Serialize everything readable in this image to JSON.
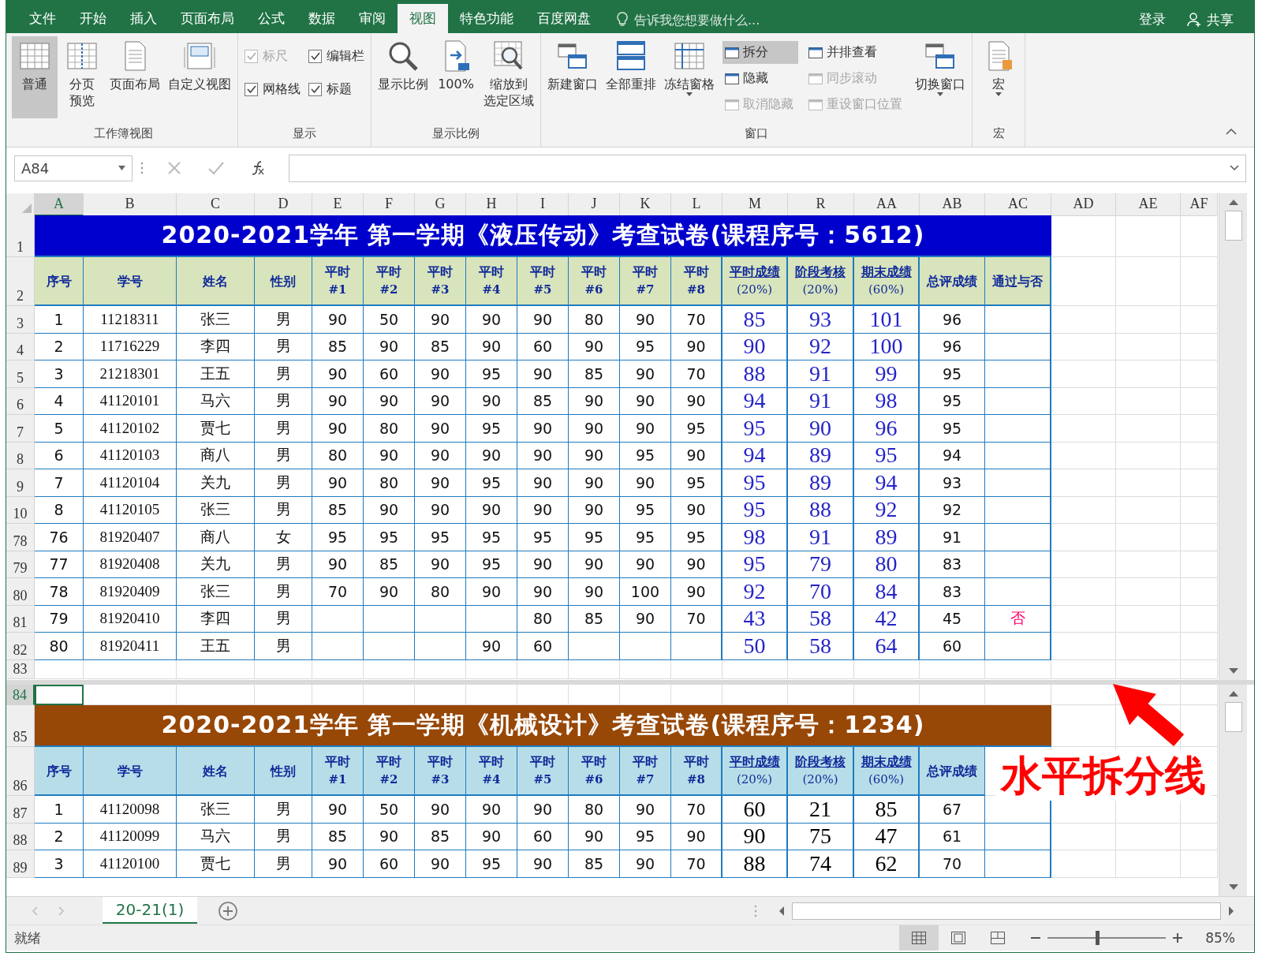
{
  "menu_tabs": [
    {
      "label": "文件",
      "selected": false
    },
    {
      "label": "开始",
      "selected": false
    },
    {
      "label": "插入",
      "selected": false
    },
    {
      "label": "页面布局",
      "selected": false
    },
    {
      "label": "公式",
      "selected": false
    },
    {
      "label": "数据",
      "selected": false
    },
    {
      "label": "审阅",
      "selected": false
    },
    {
      "label": "视图",
      "selected": true
    },
    {
      "label": "特色功能",
      "selected": false
    },
    {
      "label": "百度网盘",
      "selected": false
    }
  ],
  "tell_me": {
    "placeholder": "告诉我您想要做什么..."
  },
  "account": {
    "login": "登录",
    "share": "共享"
  },
  "ribbon_groups": [
    {
      "label": "工作簿视图",
      "items": [
        {
          "kind": "large",
          "label": "普通",
          "selected": true
        },
        {
          "kind": "large",
          "lines": [
            "分页",
            "预览"
          ],
          "selected": false
        },
        {
          "kind": "large",
          "label": "页面布局",
          "selected": false
        },
        {
          "kind": "large",
          "label": "自定义视图",
          "selected": false
        }
      ]
    },
    {
      "label": "显示",
      "items": [
        {
          "kind": "stack",
          "items": [
            {
              "kind": "check",
              "label": "标尺",
              "checked": true,
              "disabled": true
            },
            {
              "kind": "check",
              "label": "网格线",
              "checked": true,
              "disabled": false
            }
          ]
        },
        {
          "kind": "stack",
          "items": [
            {
              "kind": "check",
              "label": "编辑栏",
              "checked": true,
              "disabled": false
            },
            {
              "kind": "check",
              "label": "标题",
              "checked": true,
              "disabled": false
            }
          ]
        }
      ]
    },
    {
      "label": "显示比例",
      "items": [
        {
          "kind": "large",
          "label": "显示比例"
        },
        {
          "kind": "large",
          "label": "100%"
        },
        {
          "kind": "large",
          "lines": [
            "缩放到",
            "选定区域"
          ]
        }
      ]
    },
    {
      "label": "窗口",
      "items": [
        {
          "kind": "large",
          "label": "新建窗口"
        },
        {
          "kind": "large",
          "label": "全部重排"
        },
        {
          "kind": "large",
          "label": "冻结窗格",
          "dropdown": true
        },
        {
          "kind": "stack",
          "items": [
            {
              "kind": "small",
              "label": "拆分",
              "selected": true,
              "disabled": false
            },
            {
              "kind": "small",
              "label": "隐藏",
              "selected": false,
              "disabled": false
            },
            {
              "kind": "small",
              "label": "取消隐藏",
              "selected": false,
              "disabled": true
            }
          ]
        },
        {
          "kind": "stack",
          "items": [
            {
              "kind": "small",
              "label": "并排查看",
              "selected": false,
              "disabled": false
            },
            {
              "kind": "small",
              "label": "同步滚动",
              "selected": false,
              "disabled": true
            },
            {
              "kind": "small",
              "label": "重设窗口位置",
              "selected": false,
              "disabled": true
            }
          ]
        },
        {
          "kind": "large",
          "label": "切换窗口",
          "dropdown": true
        }
      ]
    },
    {
      "label": "宏",
      "items": [
        {
          "kind": "large",
          "label": "宏",
          "dropdown": true
        }
      ]
    }
  ],
  "formula_bar": {
    "name_box": "A84"
  },
  "columns": [
    {
      "label": "A",
      "selected": true
    },
    {
      "label": "B",
      "selected": false
    },
    {
      "label": "C",
      "selected": false
    },
    {
      "label": "D",
      "selected": false
    },
    {
      "label": "E",
      "selected": false
    },
    {
      "label": "F",
      "selected": false
    },
    {
      "label": "G",
      "selected": false
    },
    {
      "label": "H",
      "selected": false
    },
    {
      "label": "I",
      "selected": false
    },
    {
      "label": "J",
      "selected": false
    },
    {
      "label": "K",
      "selected": false
    },
    {
      "label": "L",
      "selected": false
    },
    {
      "label": "M",
      "selected": false
    },
    {
      "label": "R",
      "selected": false
    },
    {
      "label": "AA",
      "selected": false
    },
    {
      "label": "AB",
      "selected": false
    },
    {
      "label": "AC",
      "selected": false
    },
    {
      "label": "AD",
      "selected": false
    },
    {
      "label": "AE",
      "selected": false
    },
    {
      "label": "AF",
      "selected": false
    }
  ],
  "panes": [
    {
      "kind": "primary",
      "title_row": "1",
      "title": "2020-2021学年 第一学期《液压传动》考查试卷(课程序号：5612)",
      "header_row": "2",
      "headers": [
        {
          "kind": "plain",
          "label": "序号"
        },
        {
          "kind": "plain",
          "label": "学号"
        },
        {
          "kind": "plain",
          "label": "姓名"
        },
        {
          "kind": "plain",
          "label": "性别"
        },
        {
          "kind": "item",
          "label": "平时",
          "sub": "#1"
        },
        {
          "kind": "item",
          "label": "平时",
          "sub": "#2"
        },
        {
          "kind": "item",
          "label": "平时",
          "sub": "#3"
        },
        {
          "kind": "item",
          "label": "平时",
          "sub": "#4"
        },
        {
          "kind": "item",
          "label": "平时",
          "sub": "#5"
        },
        {
          "kind": "item",
          "label": "平时",
          "sub": "#6"
        },
        {
          "kind": "item",
          "label": "平时",
          "sub": "#7"
        },
        {
          "kind": "item",
          "label": "平时",
          "sub": "#8"
        },
        {
          "kind": "weighted",
          "label": "平时成绩",
          "sub": "(20%)"
        },
        {
          "kind": "weighted",
          "label": "阶段考核",
          "sub": "(20%)"
        },
        {
          "kind": "weighted",
          "label": "期末成绩",
          "sub": "(60%)"
        },
        {
          "kind": "plain",
          "label": "总评成绩"
        },
        {
          "kind": "plain",
          "label": "通过与否"
        }
      ],
      "rows": [
        {
          "row": "3",
          "cells": [
            "1",
            "11218311",
            "张三",
            "男",
            "90",
            "50",
            "90",
            "90",
            "90",
            "80",
            "90",
            "70",
            "85",
            "93",
            "101",
            "96",
            null
          ]
        },
        {
          "row": "4",
          "cells": [
            "2",
            "11716229",
            "李四",
            "男",
            "85",
            "90",
            "85",
            "90",
            "60",
            "90",
            "95",
            "90",
            "90",
            "92",
            "100",
            "96",
            null
          ]
        },
        {
          "row": "5",
          "cells": [
            "3",
            "21218301",
            "王五",
            "男",
            "90",
            "60",
            "90",
            "95",
            "90",
            "85",
            "90",
            "70",
            "88",
            "91",
            "99",
            "95",
            null
          ]
        },
        {
          "row": "6",
          "cells": [
            "4",
            "41120101",
            "马六",
            "男",
            "90",
            "90",
            "90",
            "90",
            "85",
            "90",
            "90",
            "90",
            "94",
            "91",
            "98",
            "95",
            null
          ]
        },
        {
          "row": "7",
          "cells": [
            "5",
            "41120102",
            "贾七",
            "男",
            "90",
            "80",
            "90",
            "95",
            "90",
            "90",
            "90",
            "95",
            "95",
            "90",
            "96",
            "95",
            null
          ]
        },
        {
          "row": "8",
          "cells": [
            "6",
            "41120103",
            "商八",
            "男",
            "80",
            "90",
            "90",
            "90",
            "90",
            "90",
            "95",
            "90",
            "94",
            "89",
            "95",
            "94",
            null
          ]
        },
        {
          "row": "9",
          "cells": [
            "7",
            "41120104",
            "关九",
            "男",
            "90",
            "80",
            "90",
            "95",
            "90",
            "90",
            "90",
            "95",
            "95",
            "89",
            "94",
            "93",
            null
          ]
        },
        {
          "row": "10",
          "cells": [
            "8",
            "41120105",
            "张三",
            "男",
            "85",
            "90",
            "90",
            "90",
            "90",
            "90",
            "95",
            "90",
            "95",
            "88",
            "92",
            "92",
            null
          ]
        },
        {
          "row": "78",
          "cells": [
            "76",
            "81920407",
            "商八",
            "女",
            "95",
            "95",
            "95",
            "95",
            "95",
            "95",
            "95",
            "95",
            "98",
            "91",
            "89",
            "91",
            null
          ]
        },
        {
          "row": "79",
          "cells": [
            "77",
            "81920408",
            "关九",
            "男",
            "90",
            "85",
            "90",
            "95",
            "90",
            "90",
            "90",
            "90",
            "95",
            "79",
            "80",
            "83",
            null
          ]
        },
        {
          "row": "80",
          "cells": [
            "78",
            "81920409",
            "张三",
            "男",
            "70",
            "90",
            "80",
            "90",
            "90",
            "90",
            "100",
            "90",
            "92",
            "70",
            "84",
            "83",
            null
          ]
        },
        {
          "row": "81",
          "cells": [
            "79",
            "81920410",
            "李四",
            "男",
            null,
            null,
            null,
            null,
            "80",
            "85",
            "90",
            "70",
            "43",
            "58",
            "42",
            "45",
            "否"
          ]
        },
        {
          "row": "82",
          "cells": [
            "80",
            "81920411",
            "王五",
            "男",
            null,
            null,
            null,
            "90",
            "60",
            null,
            null,
            null,
            "50",
            "58",
            "64",
            "60",
            null
          ]
        }
      ],
      "trail_rows": [
        {
          "row": "83",
          "selected": false
        }
      ]
    },
    {
      "kind": "secondary",
      "lead_rows": [
        {
          "row": "84",
          "selected": true
        }
      ],
      "title_row": "85",
      "title": "2020-2021学年 第一学期《机械设计》考查试卷(课程序号：1234)",
      "header_row": "86",
      "headers": [
        {
          "kind": "plain",
          "label": "序号"
        },
        {
          "kind": "plain",
          "label": "学号"
        },
        {
          "kind": "plain",
          "label": "姓名"
        },
        {
          "kind": "plain",
          "label": "性别"
        },
        {
          "kind": "item",
          "label": "平时",
          "sub": "#1"
        },
        {
          "kind": "item",
          "label": "平时",
          "sub": "#2"
        },
        {
          "kind": "item",
          "label": "平时",
          "sub": "#3"
        },
        {
          "kind": "item",
          "label": "平时",
          "sub": "#4"
        },
        {
          "kind": "item",
          "label": "平时",
          "sub": "#5"
        },
        {
          "kind": "item",
          "label": "平时",
          "sub": "#6"
        },
        {
          "kind": "item",
          "label": "平时",
          "sub": "#7"
        },
        {
          "kind": "item",
          "label": "平时",
          "sub": "#8"
        },
        {
          "kind": "weighted",
          "label": "平时成绩",
          "sub": "(20%)"
        },
        {
          "kind": "weighted",
          "label": "阶段考核",
          "sub": "(20%)"
        },
        {
          "kind": "weighted",
          "label": "期末成绩",
          "sub": "(60%)"
        },
        {
          "kind": "plain",
          "label": "总评成绩"
        }
      ],
      "rows": [
        {
          "row": "87",
          "cells": [
            "1",
            "41120098",
            "张三",
            "男",
            "90",
            "50",
            "90",
            "90",
            "90",
            "80",
            "90",
            "70",
            "60",
            "21",
            "85",
            "67",
            null
          ]
        },
        {
          "row": "88",
          "cells": [
            "2",
            "41120099",
            "马六",
            "男",
            "85",
            "90",
            "85",
            "90",
            "60",
            "90",
            "95",
            "90",
            "90",
            "75",
            "47",
            "61",
            null
          ]
        },
        {
          "row": "89",
          "cells": [
            "3",
            "41120100",
            "贾七",
            "男",
            "90",
            "60",
            "90",
            "95",
            "90",
            "85",
            "90",
            "70",
            "88",
            "74",
            "62",
            "70",
            null
          ]
        }
      ]
    }
  ],
  "annotation": {
    "label": "水平拆分线"
  },
  "sheet_tabs": [
    {
      "label": "20-21(1)",
      "selected": true
    }
  ],
  "status_bar": {
    "text": "就绪",
    "views": [
      {
        "selected": true
      },
      {
        "selected": false
      },
      {
        "selected": false
      }
    ],
    "zoom": {
      "level": 0.42,
      "reading": "85%"
    }
  }
}
